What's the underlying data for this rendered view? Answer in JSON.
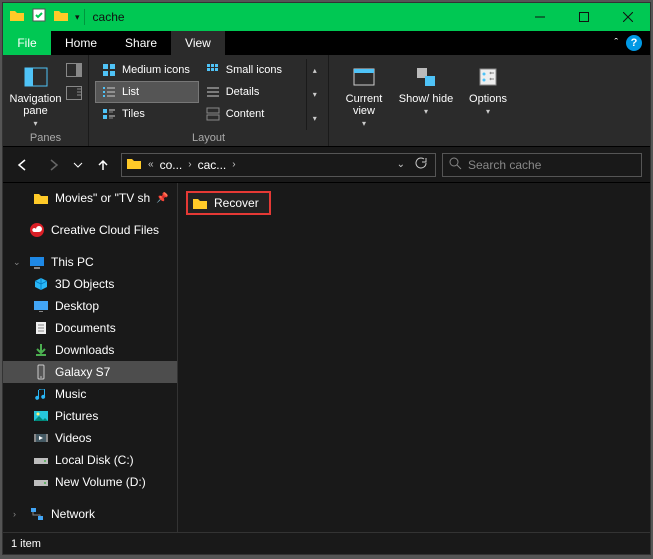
{
  "titlebar": {
    "title": "cache"
  },
  "tabs": {
    "file": "File",
    "home": "Home",
    "share": "Share",
    "view": "View"
  },
  "ribbon": {
    "panes_label": "Panes",
    "layout_label": "Layout",
    "navpane_btn": "Navigation pane",
    "layout": {
      "medium": "Medium icons",
      "small": "Small icons",
      "list": "List",
      "details": "Details",
      "tiles": "Tiles",
      "content": "Content"
    },
    "current_view": "Current view",
    "show_hide": "Show/ hide",
    "options": "Options"
  },
  "address": {
    "crumb1": "co...",
    "crumb2": "cac...",
    "search_placeholder": "Search cache"
  },
  "sidebar": {
    "movies": "Movies\" or \"TV sh",
    "creative": "Creative Cloud Files",
    "thispc": "This PC",
    "objects3d": "3D Objects",
    "desktop": "Desktop",
    "documents": "Documents",
    "downloads": "Downloads",
    "galaxy": "Galaxy S7",
    "music": "Music",
    "pictures": "Pictures",
    "videos": "Videos",
    "localdisk": "Local Disk (C:)",
    "newvolume": "New Volume (D:)",
    "network": "Network"
  },
  "files": {
    "recover": "Recover"
  },
  "status": {
    "count": "1 item"
  }
}
